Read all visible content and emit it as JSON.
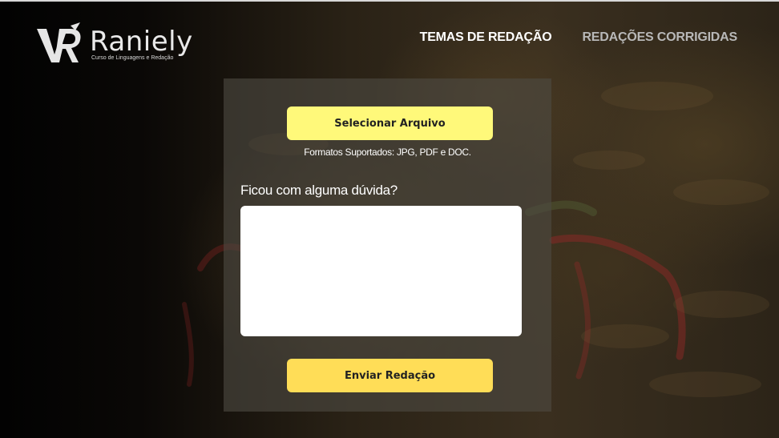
{
  "header": {
    "logo": {
      "word": "Raniely",
      "tagline": "Curso de Linguagens e Redação",
      "icon": "vr-monogram-icon"
    },
    "nav": [
      {
        "label": "TEMAS DE REDAÇÃO",
        "active": true
      },
      {
        "label": "REDAÇÕES CORRIGIDAS",
        "active": false
      }
    ]
  },
  "upload": {
    "select_label": "Selecionar Arquivo",
    "formats_text": "Formatos Suportados: JPG, PDF e DOC."
  },
  "question": {
    "label": "Ficou com alguma dúvida?",
    "value": "",
    "placeholder": ""
  },
  "submit": {
    "label": "Enviar Redação"
  },
  "colors": {
    "select_button": "#fff97a",
    "submit_button": "#ffdd57",
    "panel": "#4e4a42"
  }
}
